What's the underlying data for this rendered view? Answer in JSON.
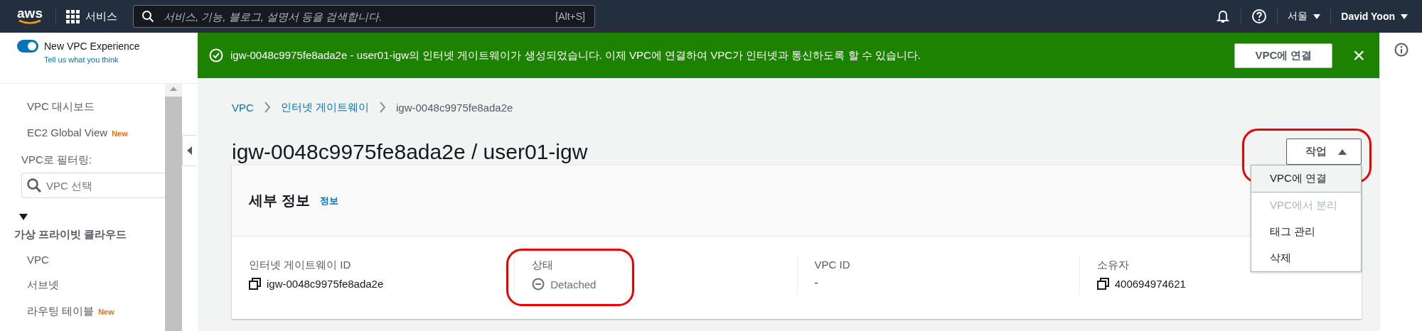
{
  "top_nav": {
    "logo": "aws",
    "services": "서비스",
    "search": {
      "placeholder": "서비스, 기능, 블로그, 설명서 등을 검색합니다.",
      "shortcut": "[Alt+S]"
    },
    "region": "서울",
    "user": "David Yoon"
  },
  "sidebar": {
    "experience_toggle": {
      "label": "New VPC Experience",
      "on": true,
      "link": "Tell us what you think"
    },
    "items": [
      {
        "label": "VPC 대시보드"
      },
      {
        "label": "EC2 Global View",
        "badge": "New"
      }
    ],
    "filter": {
      "label": "VPC로 필터링:",
      "placeholder": "VPC 선택"
    },
    "section": {
      "title": "가상 프라이빗 클라우드",
      "expanded": true,
      "items": [
        {
          "label": "VPC"
        },
        {
          "label": "서브넷"
        },
        {
          "label": "라우팅 테이블",
          "badge": "New"
        }
      ]
    }
  },
  "flash": {
    "message": "igw-0048c9975fe8ada2e - user01-igw의 인터넷 게이트웨이가 생성되었습니다. 이제 VPC에 연결하여 VPC가 인터넷과 통신하도록 할 수 있습니다.",
    "action": "VPC에 연결",
    "close": "×"
  },
  "breadcrumbs": [
    {
      "label": "VPC",
      "link": true
    },
    {
      "label": "인터넷 게이트웨이",
      "link": true
    },
    {
      "label": "igw-0048c9975fe8ada2e",
      "link": false
    }
  ],
  "page_title": "igw-0048c9975fe8ada2e / user01-igw",
  "actions": {
    "label": "작업",
    "expanded": true,
    "highlighted": true,
    "items": [
      {
        "label": "VPC에 연결",
        "disabled": false,
        "selected": true
      },
      {
        "label": "VPC에서 분리",
        "disabled": true,
        "selected": false
      },
      {
        "label": "태그 관리",
        "disabled": false,
        "selected": false
      },
      {
        "label": "삭제",
        "disabled": false,
        "selected": false
      }
    ]
  },
  "details": {
    "title": "세부 정보",
    "info_link": "정보",
    "fields": [
      {
        "label": "인터넷 게이트웨이 ID",
        "value": "igw-0048c9975fe8ada2e",
        "kind": "copy",
        "highlighted": false
      },
      {
        "label": "상태",
        "value": "Detached",
        "kind": "status",
        "highlighted": true
      },
      {
        "label": "VPC ID",
        "value": "-",
        "kind": "plain",
        "highlighted": false
      },
      {
        "label": "소유자",
        "value": "400694974621",
        "kind": "copy",
        "highlighted": false
      }
    ]
  }
}
